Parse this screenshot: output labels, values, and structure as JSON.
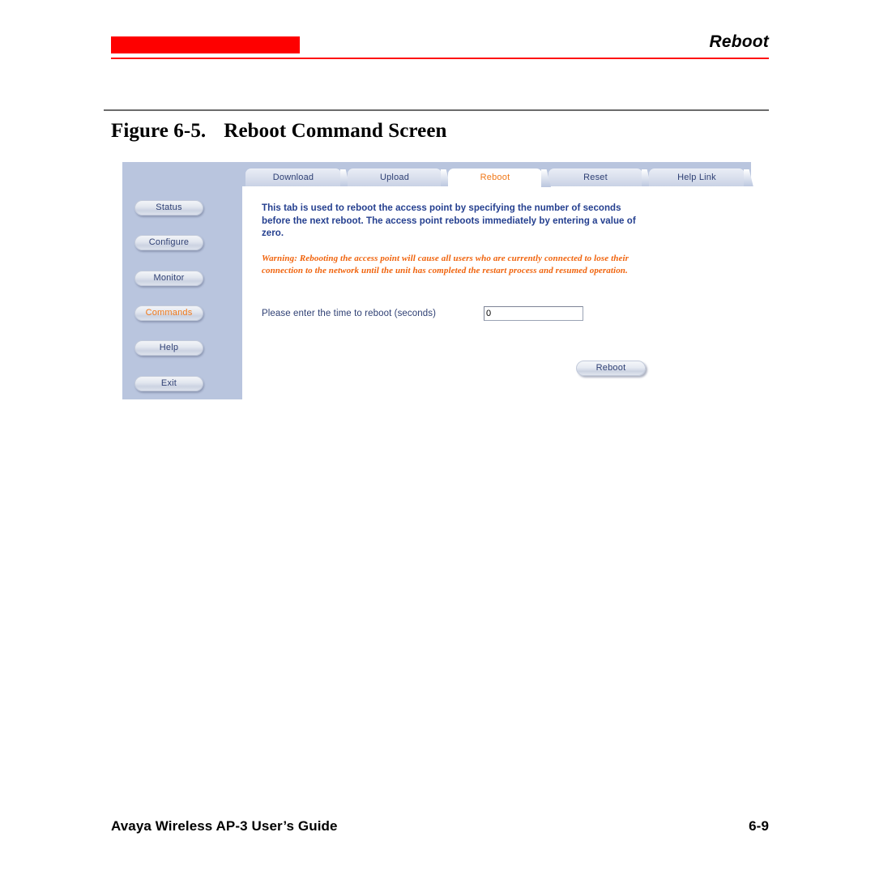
{
  "page": {
    "running_head": "Reboot",
    "figure_number": "Figure 6-5.",
    "figure_title": "Reboot Command Screen",
    "accent_red": "#fe0000",
    "rule_gray": "#6b6b6b"
  },
  "footer": {
    "title": "Avaya Wireless AP-3 User’s Guide",
    "page_number": "6-9"
  },
  "app": {
    "nav": {
      "items": [
        {
          "label": "Status",
          "active": false
        },
        {
          "label": "Configure",
          "active": false
        },
        {
          "label": "Monitor",
          "active": false
        },
        {
          "label": "Commands",
          "active": true
        },
        {
          "label": "Help",
          "active": false
        },
        {
          "label": "Exit",
          "active": false
        }
      ]
    },
    "tabs": [
      {
        "label": "Download",
        "active": false
      },
      {
        "label": "Upload",
        "active": false
      },
      {
        "label": "Reboot",
        "active": true
      },
      {
        "label": "Reset",
        "active": false
      },
      {
        "label": "Help Link",
        "active": false
      }
    ],
    "content": {
      "description": "This tab is used to reboot the access point by specifying the number of seconds before the next reboot. The access point reboots immediately by entering a value of zero.",
      "warning": "Warning: Rebooting the access point will cause all users who are currently connected to lose their connection to the network until the unit has completed the restart process and resumed operation.",
      "field_label": "Please enter the time to reboot (seconds)",
      "field_value": "0",
      "field_placeholder": "",
      "submit_label": "Reboot"
    },
    "colors": {
      "nav_background": "#b9c5de",
      "text_blue": "#243f8f",
      "active_orange": "#f07818",
      "warning_orange": "#f0630c"
    }
  }
}
